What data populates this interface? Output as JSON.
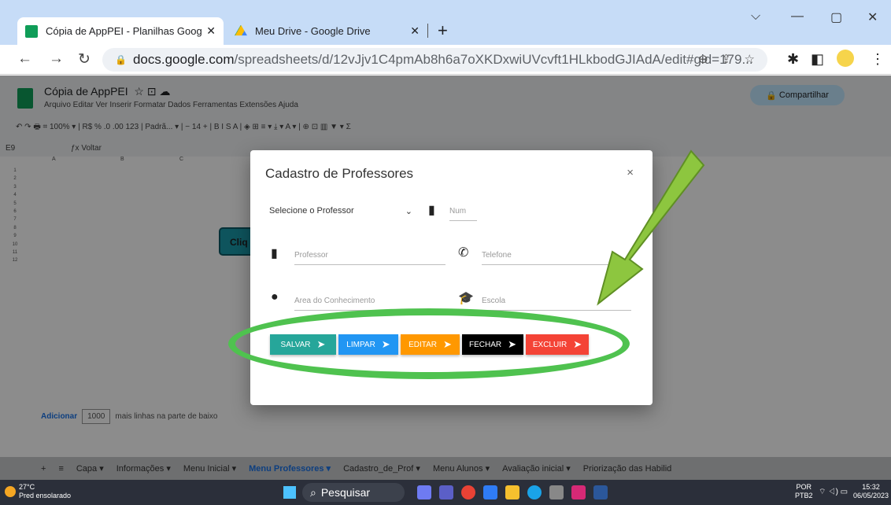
{
  "browser": {
    "tabs": [
      {
        "title": "Cópia de AppPEI - Planilhas Google",
        "close": "✕",
        "favicon_color": "#0f9d58"
      },
      {
        "title": "Meu Drive - Google Drive",
        "close": "✕",
        "favicon_color": "#fbbc04"
      }
    ],
    "new_tab": "+",
    "url_host": "docs.google.com",
    "url_path": "/spreadsheets/d/12vJjv1C4pmAb8h6a7oXKDxwiUVcvft1HLkbodGJIAdA/edit#gid=179..."
  },
  "docs": {
    "title": "Cópia de AppPEI",
    "menu": "Arquivo  Editar  Ver  Inserir  Formatar  Dados  Ferramentas  Extensões  Ajuda",
    "share_label": "Compartilhar",
    "toolbar": "↶  ↷  🖶  ⌗  100% ▾  |  R$  %  .0  .00  123  |  Padrã... ▾  |  −  14  +  |  B  I  S  A  |  ◈  ⊞  ≡ ▾  ⤓ ▾  A ▾  |  ⊕  ⊡  ▥  ▼ ▾  Σ",
    "cell_ref": "E9",
    "formula": "ƒx  Voltar",
    "columns": [
      "A",
      "B",
      "C"
    ],
    "rows": [
      "1",
      "2",
      "3",
      "4",
      "5",
      "6",
      "7",
      "8",
      "9",
      "10",
      "11",
      "12"
    ],
    "clique_label": "Cliq",
    "add_link": "Adicionar",
    "add_count": "1000",
    "add_text": "mais linhas na parte de baixo"
  },
  "sheet_tabs": [
    {
      "label": "Capa ▾",
      "current": false
    },
    {
      "label": "Informações ▾",
      "current": false
    },
    {
      "label": "Menu Inicial ▾",
      "current": false
    },
    {
      "label": "Menu Professores ▾",
      "current": true
    },
    {
      "label": "Cadastro_de_Prof ▾",
      "current": false
    },
    {
      "label": "Menu Alunos ▾",
      "current": false
    },
    {
      "label": "Avaliação inicial ▾",
      "current": false
    },
    {
      "label": "Priorização das Habilid",
      "current": false
    }
  ],
  "modal": {
    "title": "Cadastro de Professores",
    "close": "×",
    "select_label": "Selecione o Professor",
    "fields": {
      "num": "Num",
      "professor": "Professor",
      "telefone": "Telefone",
      "area": "Area do Conhecimento",
      "escola": "Escola"
    },
    "buttons": [
      {
        "label": "SALVAR",
        "color": "#26a69a"
      },
      {
        "label": "LIMPAR",
        "color": "#2196f3"
      },
      {
        "label": "EDITAR",
        "color": "#ff9800"
      },
      {
        "label": "FECHAR",
        "color": "#000000"
      },
      {
        "label": "EXCLUIR",
        "color": "#f44336"
      }
    ],
    "button_arrow": "➤"
  },
  "taskbar": {
    "temp": "27°C",
    "weather": "Pred ensolarado",
    "search": "Pesquisar",
    "lang": "POR",
    "lang2": "PTB2",
    "time": "15:32",
    "date": "06/05/2023"
  },
  "annotation_color": "#4fc24f",
  "arrow_color": "#8dc63f"
}
